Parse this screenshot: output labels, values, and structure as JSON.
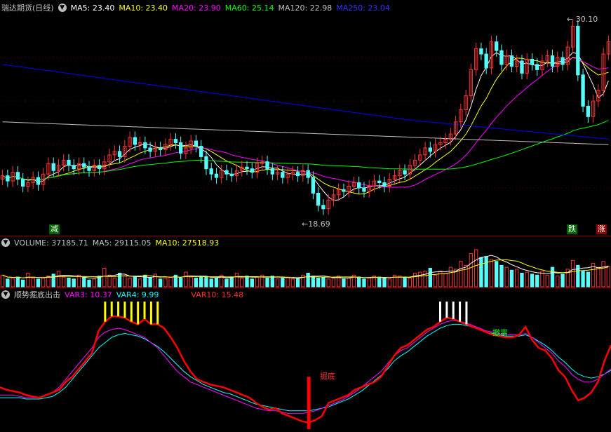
{
  "panels": {
    "price": {
      "title": "瑞达期货(日线)",
      "indicators": [
        {
          "label": "MA5:",
          "value": "23.40",
          "color": "#ffffff"
        },
        {
          "label": "MA10:",
          "value": "23.40",
          "color": "#ffff00"
        },
        {
          "label": "MA20:",
          "value": "23.90",
          "color": "#ff00ff"
        },
        {
          "label": "MA60:",
          "value": "25.14",
          "color": "#00ff00"
        },
        {
          "label": "MA120:",
          "value": "22.98",
          "color": "#c0c0c0"
        },
        {
          "label": "MA250:",
          "value": "23.04",
          "color": "#0000ff"
        }
      ],
      "high_label": "30.10",
      "low_label": "18.69",
      "tags": {
        "left": "减",
        "right1": "跌",
        "right2": "涨"
      }
    },
    "volume": {
      "indicators": [
        {
          "label": "VOLUME:",
          "value": "37185.71",
          "color": "#c0c0c0"
        },
        {
          "label": "MA5:",
          "value": "29115.05",
          "color": "#c0c0c0"
        },
        {
          "label": "MA10:",
          "value": "27518.93",
          "color": "#ffff00"
        }
      ]
    },
    "indicator": {
      "title": "顺势掘底出击",
      "indicators": [
        {
          "label": "VAR3:",
          "value": "10.37",
          "color": "#ff00ff"
        },
        {
          "label": "VAR4:",
          "value": "9.99",
          "color": "#00ffff"
        },
        {
          "label": "VAR10:",
          "value": "15.48",
          "color": "#ff0000"
        }
      ],
      "bottom_label": "掘底",
      "escape_label": "撤离"
    }
  },
  "colors": {
    "up": "#ff3232",
    "down": "#54fcfc",
    "background": "#000000",
    "ma5": "#ffffff",
    "ma10": "#ffff00",
    "ma20": "#ff00ff",
    "ma60": "#00ff00",
    "ma120": "#c0c0c0",
    "ma250": "#0000ff",
    "var3": "#ff00ff",
    "var4": "#00ffff",
    "var10": "#ff0000",
    "signal_yellow": "#ffff00",
    "signal_white": "#ffffff"
  },
  "chart_data": {
    "type": "candlestick",
    "closes": [
      21.2,
      20.9,
      21.4,
      21.0,
      20.6,
      20.8,
      21.1,
      20.7,
      21.3,
      21.9,
      21.5,
      21.8,
      22.1,
      21.8,
      21.6,
      21.9,
      21.7,
      21.5,
      21.8,
      21.6,
      22.0,
      22.4,
      22.6,
      22.3,
      22.9,
      23.4,
      23.0,
      23.1,
      22.8,
      22.6,
      22.8,
      22.7,
      23.0,
      23.3,
      23.1,
      22.5,
      22.8,
      23.2,
      22.9,
      22.3,
      21.6,
      21.3,
      21.1,
      21.5,
      21.3,
      21.2,
      21.5,
      21.7,
      21.6,
      21.4,
      21.9,
      22.0,
      21.6,
      21.3,
      21.4,
      21.1,
      21.3,
      21.4,
      21.2,
      21.5,
      21.1,
      20.2,
      19.5,
      19.3,
      19.8,
      20.1,
      20.4,
      20.3,
      20.6,
      20.8,
      20.5,
      20.3,
      20.6,
      20.9,
      20.8,
      20.6,
      21.0,
      21.2,
      21.5,
      21.3,
      21.8,
      22.1,
      22.4,
      22.8,
      22.6,
      23.0,
      23.1,
      23.3,
      23.6,
      24.3,
      25.0,
      25.8,
      27.3,
      28.5,
      28.2,
      27.4,
      28.9,
      28.4,
      27.6,
      28.1,
      27.5,
      27.8,
      27.1,
      27.9,
      27.6,
      27.3,
      27.8,
      28.1,
      27.5,
      28.0,
      27.6,
      28.6,
      29.8,
      27.0,
      25.2,
      24.6,
      25.5,
      26.1,
      28.2,
      28.9
    ],
    "volumes": [
      12,
      8,
      9,
      10,
      7,
      14,
      9,
      8,
      9,
      11,
      13,
      16,
      10,
      9,
      8,
      12,
      10,
      7,
      8,
      11,
      19,
      12,
      9,
      14,
      11,
      9,
      10,
      8,
      12,
      9,
      13,
      8,
      9,
      10,
      12,
      9,
      15,
      10,
      9,
      11,
      10,
      8,
      9,
      12,
      8,
      10,
      14,
      9,
      11,
      8,
      10,
      12,
      9,
      11,
      8,
      9,
      10,
      8,
      9,
      12,
      14,
      11,
      9,
      10,
      8,
      9,
      11,
      8,
      9,
      12,
      10,
      8,
      9,
      11,
      10,
      9,
      8,
      12,
      11,
      10,
      9,
      14,
      15,
      16,
      19,
      12,
      16,
      14,
      20,
      18,
      26,
      22,
      34,
      38,
      30,
      31,
      28,
      26,
      22,
      20,
      17,
      18,
      14,
      15,
      13,
      12,
      16,
      12,
      20,
      11,
      13,
      18,
      27,
      22,
      16,
      15,
      24,
      20,
      26,
      21
    ],
    "var10": [
      32,
      30,
      29,
      28,
      26,
      25,
      24,
      26,
      28,
      30,
      36,
      40,
      46,
      52,
      58,
      75,
      82,
      86,
      86,
      85,
      82,
      80,
      84,
      80,
      80,
      77,
      70,
      62,
      52,
      44,
      38,
      36,
      34,
      33,
      32,
      30,
      28,
      26,
      24,
      20,
      17,
      15,
      16,
      12,
      10,
      8,
      6,
      5,
      7,
      10,
      20,
      22,
      24,
      26,
      30,
      32,
      34,
      36,
      40,
      48,
      56,
      62,
      64,
      68,
      72,
      76,
      78,
      82,
      85,
      84,
      82,
      80,
      78,
      76,
      74,
      72,
      71,
      70,
      70,
      72,
      78,
      68,
      62,
      60,
      54,
      45,
      40,
      30,
      22,
      24,
      28,
      36,
      52,
      64
    ],
    "var3": [
      26,
      26,
      26,
      25,
      24,
      24,
      24,
      26,
      28,
      32,
      38,
      44,
      50,
      56,
      62,
      70,
      74,
      76,
      77,
      76,
      74,
      72,
      70,
      66,
      62,
      56,
      50,
      44,
      40,
      36,
      34,
      32,
      30,
      28,
      26,
      24,
      22,
      20,
      18,
      16,
      15,
      14,
      14,
      13,
      12,
      12,
      12,
      13,
      14,
      16,
      18,
      20,
      22,
      25,
      28,
      32,
      36,
      40,
      44,
      50,
      56,
      60,
      62,
      66,
      70,
      74,
      77,
      80,
      82,
      83,
      82,
      81,
      79,
      77,
      75,
      74,
      73,
      72,
      72,
      72,
      73,
      70,
      66,
      62,
      58,
      52,
      48,
      42,
      38,
      36,
      36,
      38,
      42,
      46
    ],
    "var4": [
      24,
      24,
      24,
      24,
      23,
      23,
      23,
      24,
      25,
      28,
      32,
      38,
      44,
      50,
      56,
      62,
      66,
      70,
      72,
      73,
      72,
      71,
      69,
      66,
      63,
      59,
      54,
      49,
      44,
      40,
      37,
      34,
      32,
      30,
      28,
      27,
      25,
      23,
      21,
      19,
      18,
      17,
      16,
      15,
      14,
      14,
      14,
      14,
      15,
      16,
      17,
      19,
      21,
      23,
      26,
      29,
      33,
      37,
      41,
      46,
      52,
      56,
      59,
      63,
      67,
      71,
      74,
      77,
      79,
      80,
      80,
      79,
      78,
      76,
      74,
      73,
      72,
      71,
      71,
      71,
      72,
      70,
      67,
      64,
      60,
      55,
      51,
      46,
      42,
      40,
      39,
      40,
      42,
      45
    ],
    "ylim_price": [
      18.0,
      30.5
    ],
    "x_count": 120
  }
}
